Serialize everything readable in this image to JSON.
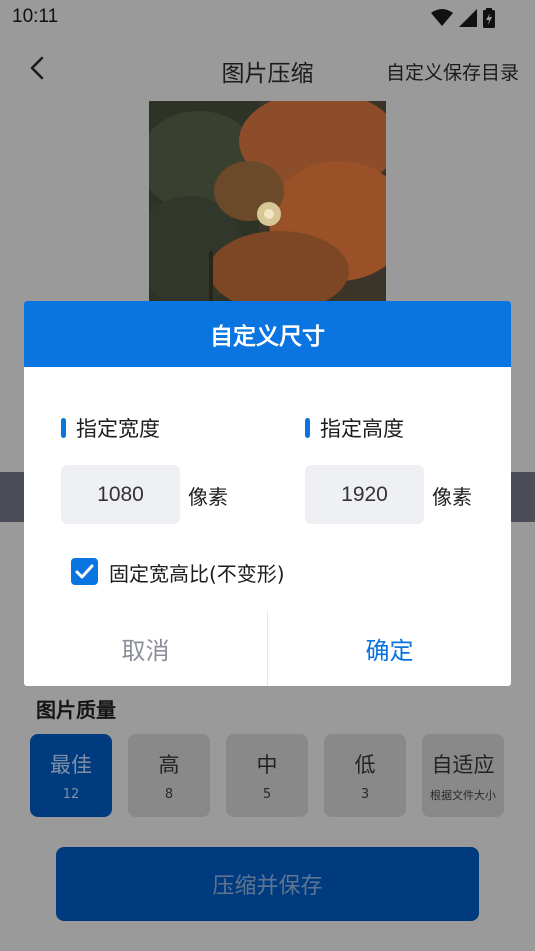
{
  "status_bar": {
    "time": "10:11"
  },
  "app_bar": {
    "title": "图片压缩",
    "action": "自定义保存目录"
  },
  "quality": {
    "title": "图片质量",
    "options": [
      {
        "label": "最佳",
        "value": "12",
        "selected": true
      },
      {
        "label": "高",
        "value": "8"
      },
      {
        "label": "中",
        "value": "5"
      },
      {
        "label": "低",
        "value": "3"
      },
      {
        "label": "自适应",
        "value": "根据文件大小"
      }
    ]
  },
  "compress_button": "压缩并保存",
  "dialog": {
    "title": "自定义尺寸",
    "width_label": "指定宽度",
    "height_label": "指定高度",
    "width_value": "1080",
    "height_value": "1920",
    "unit": "像素",
    "keep_ratio_label": "固定宽高比(不变形)",
    "keep_ratio_checked": true,
    "cancel": "取消",
    "confirm": "确定"
  },
  "colors": {
    "accent": "#0a74e0",
    "scrim": "#9a9a9a",
    "selected_quality": "#003b80"
  },
  "icons": [
    "back-arrow-icon",
    "wifi-icon",
    "signal-icon",
    "battery-icon",
    "checkmark-icon"
  ]
}
